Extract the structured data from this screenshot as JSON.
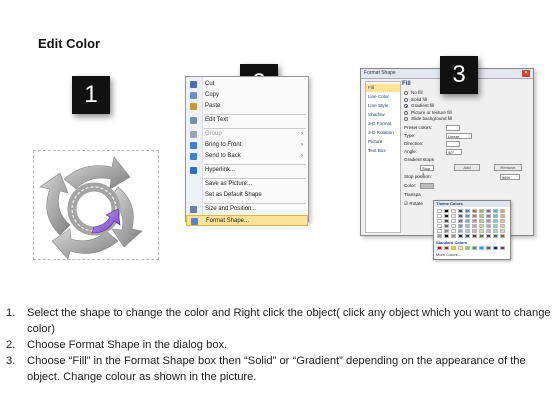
{
  "title": "Edit Color",
  "badges": [
    "1",
    "2",
    "3"
  ],
  "context_menu": {
    "items": [
      {
        "label": "Cut",
        "icon": "scissors-icon",
        "color": "#4d6fb0"
      },
      {
        "label": "Copy",
        "icon": "copy-icon",
        "color": "#6d8fc9"
      },
      {
        "label": "Paste",
        "icon": "clipboard-icon",
        "color": "#c69a3c"
      },
      {
        "label": "Edit Text",
        "icon": "edit-text-icon",
        "color": "#7a8fa8"
      },
      {
        "label": "Group",
        "icon": "group-icon",
        "color": "#9aa3b0",
        "disabled": true,
        "submenu": true
      },
      {
        "label": "Bring to Front",
        "icon": "bring-front-icon",
        "color": "#3f7fd1",
        "submenu": true
      },
      {
        "label": "Send to Back",
        "icon": "send-back-icon",
        "color": "#3f7fd1",
        "submenu": true
      },
      {
        "label": "Hyperlink...",
        "icon": "hyperlink-icon",
        "color": "#2f6fc4"
      },
      {
        "label": "Save as Picture...",
        "icon": "",
        "color": ""
      },
      {
        "label": "Set as Default Shape",
        "icon": "",
        "color": ""
      },
      {
        "label": "Size and Position...",
        "icon": "size-position-icon",
        "color": "#6a7da6"
      },
      {
        "label": "Format Shape...",
        "icon": "format-shape-icon",
        "color": "#4a86d8",
        "active": true
      }
    ]
  },
  "format_dialog": {
    "title": "Format Shape",
    "categories": [
      "Fill",
      "Line Color",
      "Line Style",
      "Shadow",
      "3-D Format",
      "3-D Rotation",
      "Picture",
      "Text Box"
    ],
    "fill_heading": "Fill",
    "fill_options": [
      {
        "label": "No fill",
        "selected": false
      },
      {
        "label": "Solid fill",
        "selected": false
      },
      {
        "label": "Gradient fill",
        "selected": true
      },
      {
        "label": "Picture or texture fill",
        "selected": false
      },
      {
        "label": "Slide background fill",
        "selected": false
      }
    ],
    "fields": {
      "preset_colors": "Preset colors:",
      "type": "Type:",
      "type_value": "Linear",
      "direction": "Direction:",
      "angle": "Angle:",
      "angle_value": "90°",
      "gradient_stops": "Gradient stops",
      "stop_value": "Stop 1",
      "add": "Add",
      "remove": "Remove",
      "stop_position": "Stop position:",
      "stop_position_value": "96%",
      "color": "Color:",
      "transparency": "Transpa",
      "rotate": "Rotate"
    },
    "palette": {
      "theme_colors": "Theme Colors",
      "standard_colors": "Standard Colors",
      "more_colors": "More Colors...",
      "theme_columns": [
        "#ffffff",
        "#000000",
        "#eeece1",
        "#1f497d",
        "#4f81bd",
        "#c0504d",
        "#9bbb59",
        "#8064a2",
        "#4bacc6",
        "#f79646"
      ],
      "standard": [
        "#c00000",
        "#ff0000",
        "#ffc000",
        "#ffff00",
        "#92d050",
        "#00b050",
        "#00b0f0",
        "#0070c0",
        "#002060",
        "#7030a0"
      ]
    }
  },
  "steps": [
    {
      "num": "1.",
      "text": "Select the shape to change the color and Right click the object( click any object which you want to change color)"
    },
    {
      "num": "2.",
      "text": "Choose Format Shape in the dialog box."
    },
    {
      "num": "3.",
      "text": "Choose “Fill” in the Format Shape box then “Solid” or “Gradient” depending on the appearance of the object. Change colour as shown in the picture."
    }
  ]
}
